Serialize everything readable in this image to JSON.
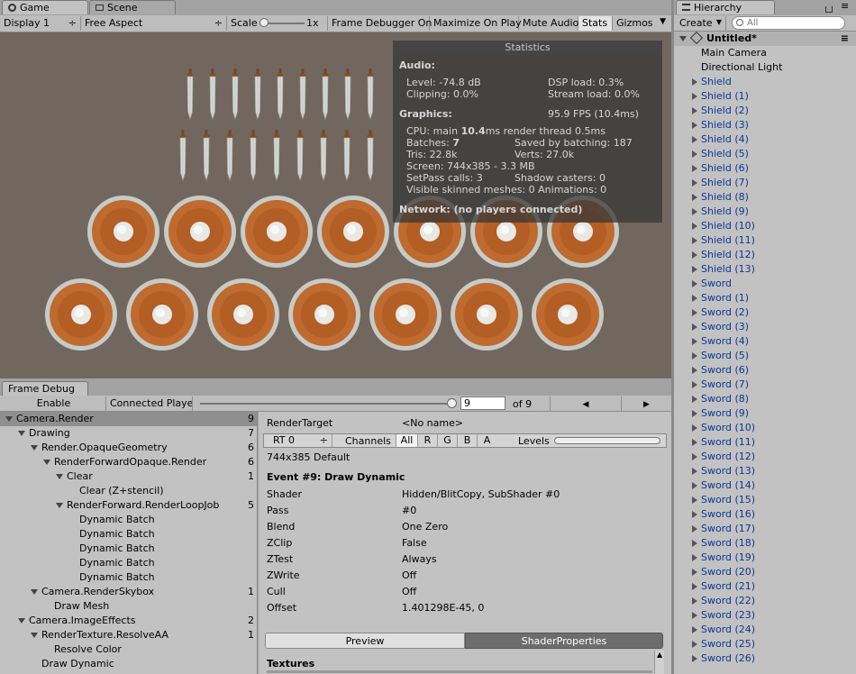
{
  "game_tabs": {
    "game": "Game",
    "scene": "Scene"
  },
  "game_toolbar": {
    "display": "Display 1",
    "aspect": "Free Aspect",
    "scale_label": "Scale",
    "scale_value": "1x",
    "frame_debugger": "Frame Debugger On",
    "maximize": "Maximize On Play",
    "mute": "Mute Audio",
    "stats": "Stats",
    "gizmos": "Gizmos"
  },
  "statistics": {
    "title": "Statistics",
    "audio_header": "Audio:",
    "level": "Level: -74.8 dB",
    "dsp": "DSP load: 0.3%",
    "clipping": "Clipping: 0.0%",
    "stream": "Stream load: 0.0%",
    "graphics_header": "Graphics:",
    "fps": "95.9 FPS (10.4ms)",
    "cpu_prefix": "CPU: main ",
    "cpu_main": "10.4",
    "cpu_suffix": "ms  render thread 0.5ms",
    "batches_prefix": "Batches: ",
    "batches": "7",
    "saved": "Saved by batching: 187",
    "tris": "Tris: 22.8k",
    "verts": "Verts: 27.0k",
    "screen": "Screen: 744x385 - 3.3 MB",
    "setpass": "SetPass calls: 3",
    "shadow": "Shadow casters: 0",
    "skinned": "Visible skinned meshes: 0  Animations: 0",
    "network": "Network: (no players connected)"
  },
  "frame_debug": {
    "tab": "Frame Debug",
    "enable": "Enable",
    "connected": "Connected Playe",
    "event_value": "9",
    "of_total": "of 9",
    "prev_arrow": "◀",
    "next_arrow": "▶",
    "tree": [
      {
        "label": "Camera.Render",
        "count": "9",
        "indent": 0,
        "arrow": "down",
        "selected": true
      },
      {
        "label": "Drawing",
        "count": "7",
        "indent": 1,
        "arrow": "down"
      },
      {
        "label": "Render.OpaqueGeometry",
        "count": "6",
        "indent": 2,
        "arrow": "down"
      },
      {
        "label": "RenderForwardOpaque.Render",
        "count": "6",
        "indent": 3,
        "arrow": "down"
      },
      {
        "label": "Clear",
        "count": "1",
        "indent": 4,
        "arrow": "down"
      },
      {
        "label": "Clear (Z+stencil)",
        "count": "",
        "indent": 5,
        "arrow": "none"
      },
      {
        "label": "RenderForward.RenderLoopJob",
        "count": "5",
        "indent": 4,
        "arrow": "down"
      },
      {
        "label": "Dynamic Batch",
        "count": "",
        "indent": 5,
        "arrow": "none"
      },
      {
        "label": "Dynamic Batch",
        "count": "",
        "indent": 5,
        "arrow": "none"
      },
      {
        "label": "Dynamic Batch",
        "count": "",
        "indent": 5,
        "arrow": "none"
      },
      {
        "label": "Dynamic Batch",
        "count": "",
        "indent": 5,
        "arrow": "none"
      },
      {
        "label": "Dynamic Batch",
        "count": "",
        "indent": 5,
        "arrow": "none"
      },
      {
        "label": "Camera.RenderSkybox",
        "count": "1",
        "indent": 2,
        "arrow": "down"
      },
      {
        "label": "Draw Mesh",
        "count": "",
        "indent": 3,
        "arrow": "none"
      },
      {
        "label": "Camera.ImageEffects",
        "count": "2",
        "indent": 1,
        "arrow": "down"
      },
      {
        "label": "RenderTexture.ResolveAA",
        "count": "1",
        "indent": 2,
        "arrow": "down"
      },
      {
        "label": "Resolve Color",
        "count": "",
        "indent": 3,
        "arrow": "none"
      },
      {
        "label": "Draw Dynamic",
        "count": "",
        "indent": 2,
        "arrow": "none"
      }
    ],
    "render_target_label": "RenderTarget",
    "render_target_value": "<No name>",
    "rt_select": "RT 0",
    "channels_label": "Channels",
    "channels": [
      "All",
      "R",
      "G",
      "B",
      "A"
    ],
    "levels_label": "Levels",
    "resolution": "744x385 Default",
    "event_title": "Event #9: Draw Dynamic",
    "properties": [
      {
        "k": "Shader",
        "v": "Hidden/BlitCopy, SubShader #0"
      },
      {
        "k": "Pass",
        "v": "#0"
      },
      {
        "k": "Blend",
        "v": "One Zero"
      },
      {
        "k": "ZClip",
        "v": "False"
      },
      {
        "k": "ZTest",
        "v": "Always"
      },
      {
        "k": "ZWrite",
        "v": "Off"
      },
      {
        "k": "Cull",
        "v": "Off"
      },
      {
        "k": "Offset",
        "v": "1.401298E-45, 0"
      }
    ],
    "preview_tab": "Preview",
    "shader_props_tab": "ShaderProperties",
    "textures_header": "Textures"
  },
  "hierarchy": {
    "tab": "Hierarchy",
    "create": "Create",
    "search_placeholder": "All",
    "scene_name": "Untitled*",
    "items": [
      {
        "label": "Main Camera",
        "arrow": false,
        "black": true
      },
      {
        "label": "Directional Light",
        "arrow": false,
        "black": true
      },
      {
        "label": "Shield",
        "arrow": true
      },
      {
        "label": "Shield (1)",
        "arrow": true
      },
      {
        "label": "Shield (2)",
        "arrow": true
      },
      {
        "label": "Shield (3)",
        "arrow": true
      },
      {
        "label": "Shield (4)",
        "arrow": true
      },
      {
        "label": "Shield (5)",
        "arrow": true
      },
      {
        "label": "Shield (6)",
        "arrow": true
      },
      {
        "label": "Shield (7)",
        "arrow": true
      },
      {
        "label": "Shield (8)",
        "arrow": true
      },
      {
        "label": "Shield (9)",
        "arrow": true
      },
      {
        "label": "Shield (10)",
        "arrow": true
      },
      {
        "label": "Shield (11)",
        "arrow": true
      },
      {
        "label": "Shield (12)",
        "arrow": true
      },
      {
        "label": "Shield (13)",
        "arrow": true
      },
      {
        "label": "Sword",
        "arrow": true
      },
      {
        "label": "Sword (1)",
        "arrow": true
      },
      {
        "label": "Sword (2)",
        "arrow": true
      },
      {
        "label": "Sword (3)",
        "arrow": true
      },
      {
        "label": "Sword (4)",
        "arrow": true
      },
      {
        "label": "Sword (5)",
        "arrow": true
      },
      {
        "label": "Sword (6)",
        "arrow": true
      },
      {
        "label": "Sword (7)",
        "arrow": true
      },
      {
        "label": "Sword (8)",
        "arrow": true
      },
      {
        "label": "Sword (9)",
        "arrow": true
      },
      {
        "label": "Sword (10)",
        "arrow": true
      },
      {
        "label": "Sword (11)",
        "arrow": true
      },
      {
        "label": "Sword (12)",
        "arrow": true
      },
      {
        "label": "Sword (13)",
        "arrow": true
      },
      {
        "label": "Sword (14)",
        "arrow": true
      },
      {
        "label": "Sword (15)",
        "arrow": true
      },
      {
        "label": "Sword (16)",
        "arrow": true
      },
      {
        "label": "Sword (17)",
        "arrow": true
      },
      {
        "label": "Sword (18)",
        "arrow": true
      },
      {
        "label": "Sword (19)",
        "arrow": true
      },
      {
        "label": "Sword (20)",
        "arrow": true
      },
      {
        "label": "Sword (21)",
        "arrow": true
      },
      {
        "label": "Sword (22)",
        "arrow": true
      },
      {
        "label": "Sword (23)",
        "arrow": true
      },
      {
        "label": "Sword (24)",
        "arrow": true
      },
      {
        "label": "Sword (25)",
        "arrow": true
      },
      {
        "label": "Sword (26)",
        "arrow": true
      }
    ]
  },
  "colors": {
    "viewport_bg": "#71675e",
    "shield_rim": "#c8ccc8",
    "shield_wood": "#c06a2c",
    "shield_boss": "#f0f0ee",
    "hierarchy_link": "#0b3794",
    "selection": "#8f8f8f"
  }
}
